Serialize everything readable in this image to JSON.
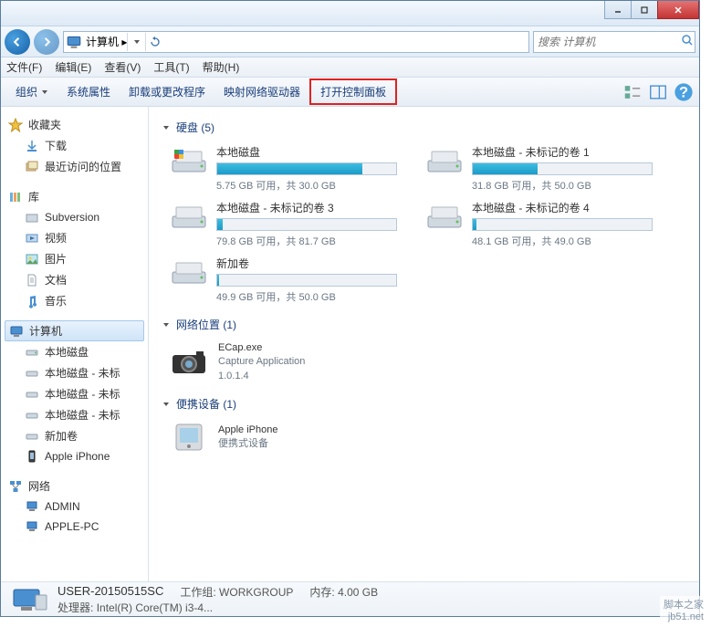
{
  "address": {
    "text": "计算机 ▸"
  },
  "search": {
    "placeholder": "搜索 计算机"
  },
  "menubar": {
    "file": "文件(F)",
    "edit": "编辑(E)",
    "view": "查看(V)",
    "tools": "工具(T)",
    "help": "帮助(H)"
  },
  "toolbar": {
    "organize": "组织",
    "sysprops": "系统属性",
    "uninstall": "卸载或更改程序",
    "mapdrive": "映射网络驱动器",
    "opencp": "打开控制面板"
  },
  "sidebar": {
    "favorites": {
      "label": "收藏夹",
      "items": [
        {
          "label": "下载"
        },
        {
          "label": "最近访问的位置"
        }
      ]
    },
    "libraries": {
      "label": "库",
      "items": [
        {
          "label": "Subversion"
        },
        {
          "label": "视频"
        },
        {
          "label": "图片"
        },
        {
          "label": "文档"
        },
        {
          "label": "音乐"
        }
      ]
    },
    "computer": {
      "label": "计算机",
      "items": [
        {
          "label": "本地磁盘"
        },
        {
          "label": "本地磁盘 - 未标"
        },
        {
          "label": "本地磁盘 - 未标"
        },
        {
          "label": "本地磁盘 - 未标"
        },
        {
          "label": "新加卷"
        },
        {
          "label": "Apple iPhone"
        }
      ]
    },
    "network": {
      "label": "网络",
      "items": [
        {
          "label": "ADMIN"
        },
        {
          "label": "APPLE-PC"
        }
      ]
    }
  },
  "main": {
    "hdds": {
      "label": "硬盘 (5)",
      "items": [
        {
          "name": "本地磁盘",
          "stats": "5.75 GB 可用，共 30.0 GB",
          "pct": 81
        },
        {
          "name": "本地磁盘 - 未标记的卷 1",
          "stats": "31.8 GB 可用，共 50.0 GB",
          "pct": 36
        },
        {
          "name": "本地磁盘 - 未标记的卷 3",
          "stats": "79.8 GB 可用，共 81.7 GB",
          "pct": 3
        },
        {
          "name": "本地磁盘 - 未标记的卷 4",
          "stats": "48.1 GB 可用，共 49.0 GB",
          "pct": 2
        },
        {
          "name": "新加卷",
          "stats": "49.9 GB 可用，共 50.0 GB",
          "pct": 1
        }
      ]
    },
    "netloc": {
      "label": "网络位置 (1)",
      "item": {
        "name": "ECap.exe",
        "line2": "Capture Application",
        "line3": "1.0.1.4"
      }
    },
    "portable": {
      "label": "便携设备 (1)",
      "item": {
        "name": "Apple iPhone",
        "line2": "便携式设备"
      }
    }
  },
  "details": {
    "name": "USER-20150515SC",
    "wg_lbl": "工作组:",
    "wg": "WORKGROUP",
    "mem_lbl": "内存:",
    "mem": "4.00 GB",
    "cpu_lbl": "处理器:",
    "cpu": "Intel(R) Core(TM) i3-4..."
  },
  "watermark": "脚本之家\njb51.net"
}
